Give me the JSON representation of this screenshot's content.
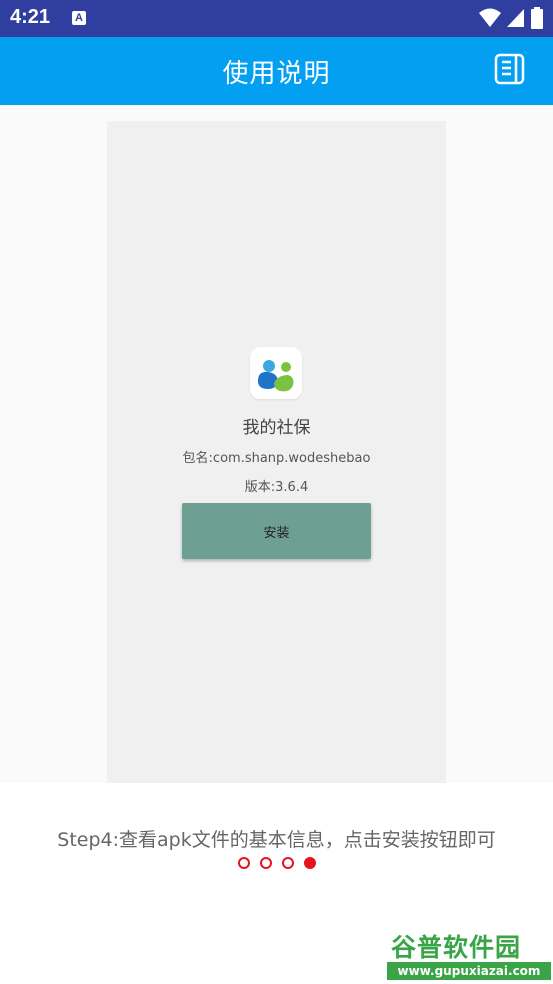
{
  "status_bar": {
    "time": "4:21",
    "notification_icon": "A"
  },
  "app_bar": {
    "title": "使用说明",
    "doc_icon": "document-icon"
  },
  "guide": {
    "app_name": "我的社保",
    "package": "包名:com.shanp.wodeshebao",
    "version": "版本:3.6.4",
    "install_label": "安装"
  },
  "step": {
    "text": "Step4:查看apk文件的基本信息，点击安装按钮即可"
  },
  "pagination": {
    "total": 4,
    "current": 4
  },
  "watermark": {
    "title": "谷普软件园",
    "url": "www.gupuxiazai.com"
  },
  "colors": {
    "status_bar": "#303f9f",
    "app_bar": "#03a0f2",
    "install_button": "#6d9f93",
    "dot_accent": "#e8141c"
  }
}
